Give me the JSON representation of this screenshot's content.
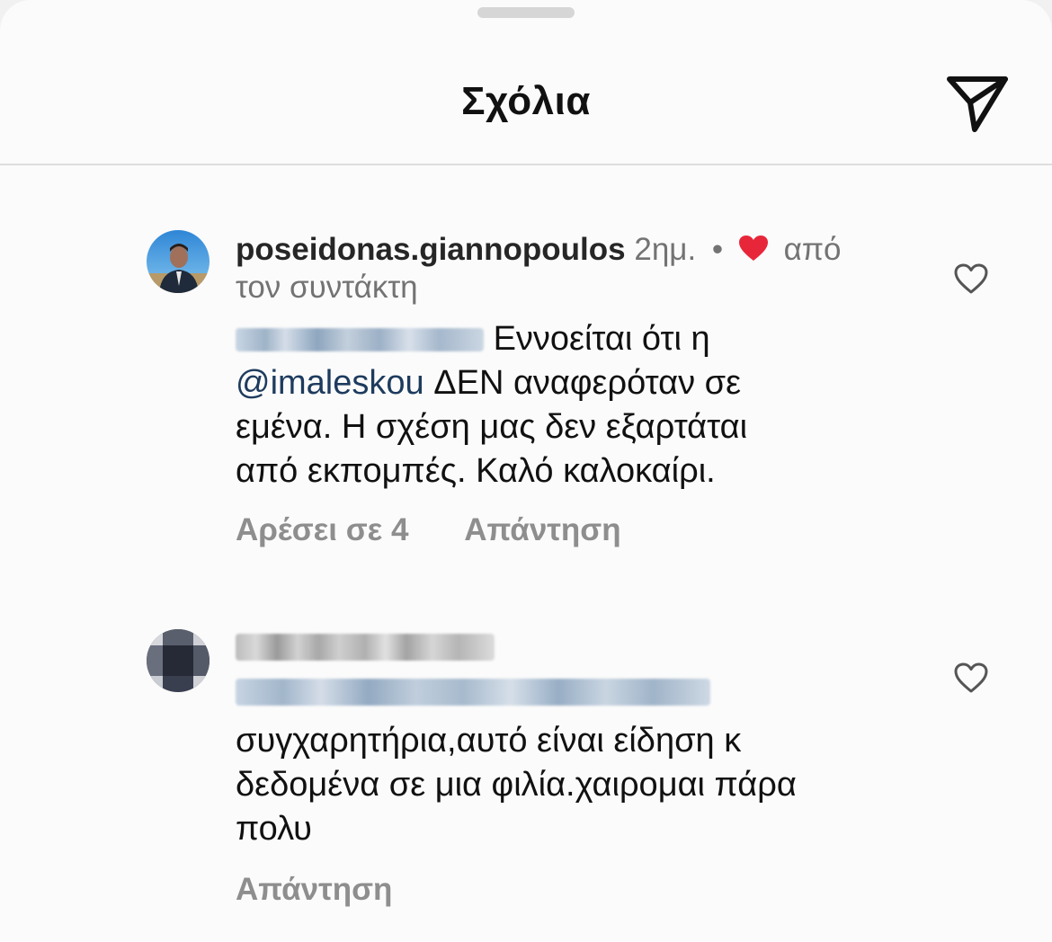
{
  "header": {
    "title": "Σχόλια",
    "share_icon": "paper-plane-icon"
  },
  "comments": [
    {
      "username": "poseidonas.giannopoulos",
      "time": "2ημ.",
      "separator": "•",
      "liked_by_author_prefix": "από",
      "liked_by_author_suffix": "τον συντάκτη",
      "text_after_redacted": "Εννοείται ότι η",
      "mention": "@imaleskou",
      "text_after_mention": "ΔΕΝ αναφερόταν σε",
      "text_line3": "εμένα. Η σχέση μας δεν εξαρτάται",
      "text_line4": "από εκπομπές. Καλό καλοκαίρι.",
      "likes_label": "Αρέσει σε 4",
      "reply_label": "Απάντηση"
    },
    {
      "text_line1": "συγχαρητήρια,αυτό είναι είδηση κ",
      "text_line2": "δεδομένα σε μια φιλία.χαιρομαι πάρα",
      "text_line3": "πολυ",
      "reply_label": "Απάντηση"
    }
  ],
  "colors": {
    "heart_red": "#e8263a",
    "mention_blue": "#1d3b5e",
    "secondary_gray": "#737373",
    "action_gray": "#8e8e8e"
  }
}
